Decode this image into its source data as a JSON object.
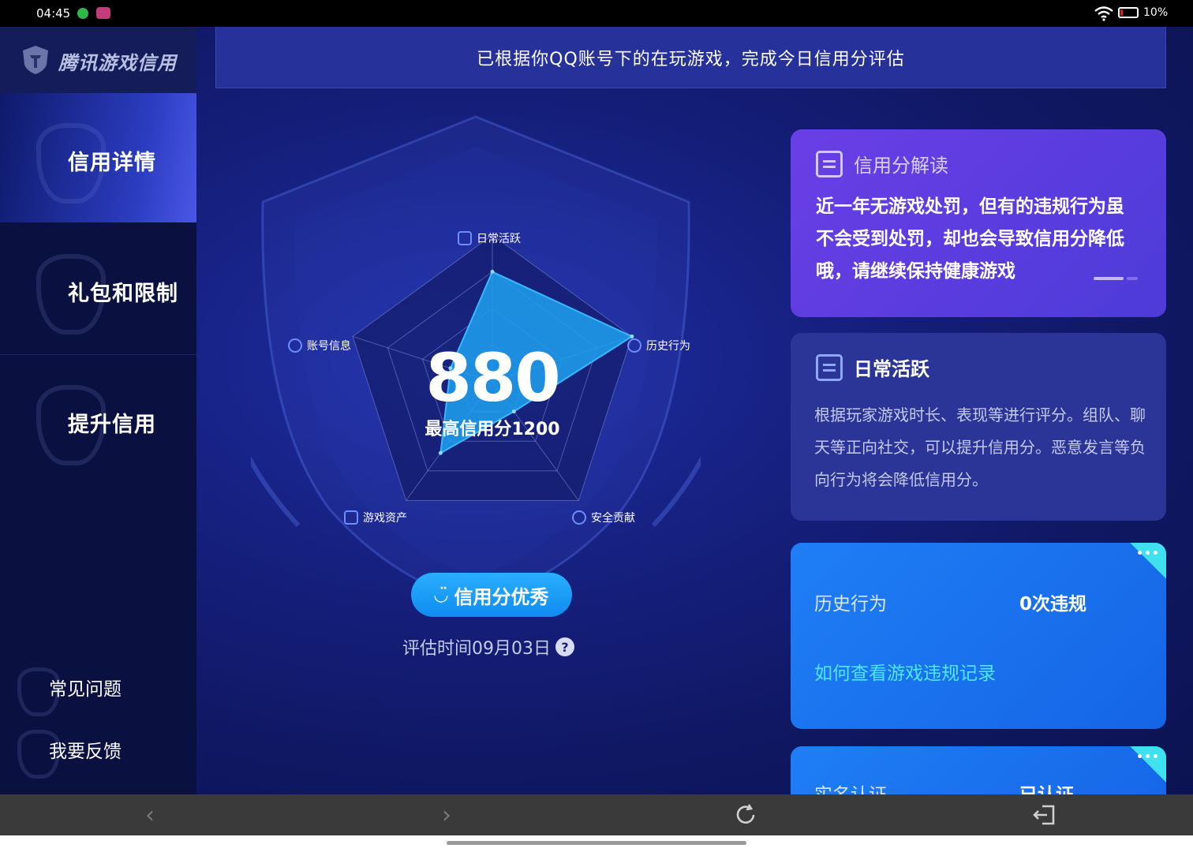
{
  "status_bar": {
    "time": "04:45",
    "battery": "10%"
  },
  "brand": {
    "name": "腾讯游戏信用"
  },
  "banner": {
    "text": "已根据你QQ账号下的在玩游戏，完成今日信用分评估"
  },
  "sidebar": {
    "items": [
      {
        "label": "信用详情",
        "active": true
      },
      {
        "label": "礼包和限制",
        "active": false
      },
      {
        "label": "提升信用",
        "active": false
      }
    ],
    "footer_items": [
      {
        "label": "常见问题"
      },
      {
        "label": "我要反馈"
      }
    ]
  },
  "score": {
    "value": "880",
    "max_label": "最高信用分1200"
  },
  "radar": {
    "axes": [
      {
        "label": "日常活跃",
        "icon": "doc-icon"
      },
      {
        "label": "历史行为",
        "icon": "clock-icon"
      },
      {
        "label": "安全贡献",
        "icon": "shield-icon"
      },
      {
        "label": "游戏资产",
        "icon": "wallet-icon"
      },
      {
        "label": "账号信息",
        "icon": "user-icon"
      }
    ],
    "values": [
      0.75,
      1.0,
      0.25,
      0.6,
      0.3
    ]
  },
  "level": {
    "label": "信用分优秀"
  },
  "evaluation": {
    "time": "评估时间09月03日",
    "help": "?"
  },
  "cards": {
    "interpretation": {
      "title": "信用分解读",
      "body": "近一年无游戏处罚，但有的违规行为虽不会受到处罚，却也会导致信用分降低哦，请继续保持健康游戏"
    },
    "daily": {
      "title": "日常活跃",
      "body": "根据玩家游戏时长、表现等进行评分。组队、聊天等正向社交，可以提升信用分。恶意发言等负向行为将会降低信用分。"
    },
    "history": {
      "label": "历史行为",
      "value": "0次违规",
      "link": "如何查看游戏违规记录",
      "more": "•••"
    },
    "realname": {
      "label": "实名认证",
      "value": "已认证",
      "more": "•••"
    }
  },
  "colors": {
    "accent": "#1e8ff5",
    "card_purple": "#5b3de0",
    "card_blue": "#1a73ee",
    "link": "#4ee7ff"
  }
}
